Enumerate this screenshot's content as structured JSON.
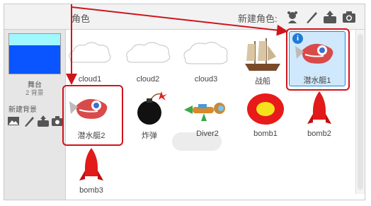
{
  "header": {
    "title": "角色",
    "new_sprite_label": "新建角色:",
    "icons": [
      "paint-sprite-icon",
      "brush-icon",
      "upload-icon",
      "camera-icon"
    ]
  },
  "stage": {
    "label": "舞台",
    "count": "2 背景",
    "new_backdrop_label": "新建背景",
    "icons": [
      "landscape-icon",
      "brush-icon",
      "upload-icon",
      "camera-icon"
    ]
  },
  "sprites": [
    {
      "name": "cloud1",
      "icon": "cloud"
    },
    {
      "name": "cloud2",
      "icon": "cloud"
    },
    {
      "name": "cloud3",
      "icon": "cloud"
    },
    {
      "name": "战船",
      "icon": "sailing-ship"
    },
    {
      "name": "潜水艇1",
      "icon": "submarine",
      "selected": true
    },
    {
      "name": "潜水艇2",
      "icon": "submarine"
    },
    {
      "name": "炸弹",
      "icon": "bomb"
    },
    {
      "name": "Diver2",
      "icon": "diver"
    },
    {
      "name": "bomb1",
      "icon": "target-bomb"
    },
    {
      "name": "bomb2",
      "icon": "rocket"
    },
    {
      "name": "bomb3",
      "icon": "rocket"
    }
  ],
  "colors": {
    "annotation_red": "#d0141c",
    "selected_blue": "#1e8bd8",
    "stage_blue": "#0a55ff",
    "stage_sky": "#9ff8ff"
  }
}
